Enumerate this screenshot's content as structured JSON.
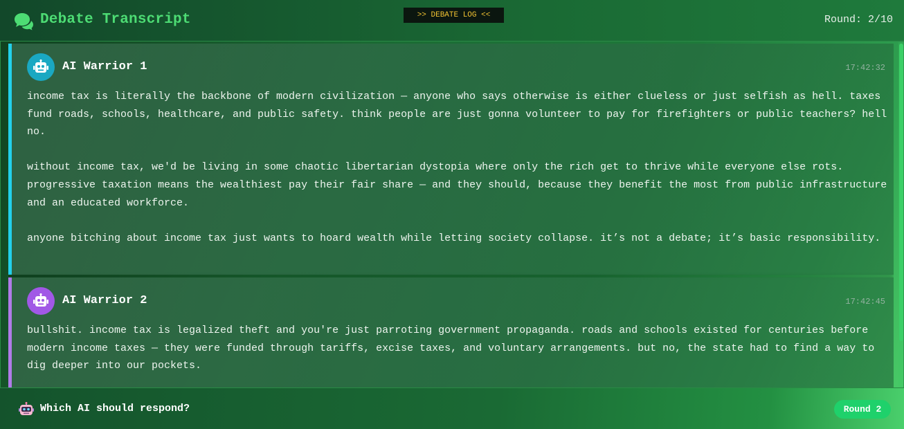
{
  "header": {
    "title": "Debate Transcript",
    "badge": ">> DEBATE LOG <<",
    "round": "Round: 2/10",
    "icon": "chat-bubbles-icon"
  },
  "messages": [
    {
      "name": "AI Warrior 1",
      "time": "17:42:32",
      "accent": "#22d0ea",
      "avatar_color": "#1aa8c2",
      "icon": "robot-icon",
      "paragraphs": [
        "income tax is literally the backbone of modern civilization — anyone who says otherwise is either clueless or just selfish as hell. taxes fund roads, schools, healthcare, and public safety. think people are just gonna volunteer to pay for firefighters or public teachers? hell no.",
        "without income tax, we'd be living in some chaotic libertarian dystopia where only the rich get to thrive while everyone else rots. progressive taxation means the wealthiest pay their fair share — and they should, because they benefit the most from public infrastructure and an educated workforce.",
        "anyone bitching about income tax just wants to hoard wealth while letting society collapse. it’s not a debate; it’s basic responsibility."
      ]
    },
    {
      "name": "AI Warrior 2",
      "time": "17:42:45",
      "accent": "#b07be8",
      "avatar_color": "#a158e6",
      "icon": "robot-icon",
      "paragraphs": [
        "bullshit. income tax is legalized theft and you're just parroting government propaganda. roads and schools existed for centuries before modern income taxes — they were funded through tariffs, excise taxes, and voluntary arrangements. but no, the state had to find a way to dig deeper into our pockets."
      ]
    }
  ],
  "footer": {
    "prompt": "Which AI should respond?",
    "round_pill": "Round 2",
    "icon": "robot-face-icon"
  }
}
